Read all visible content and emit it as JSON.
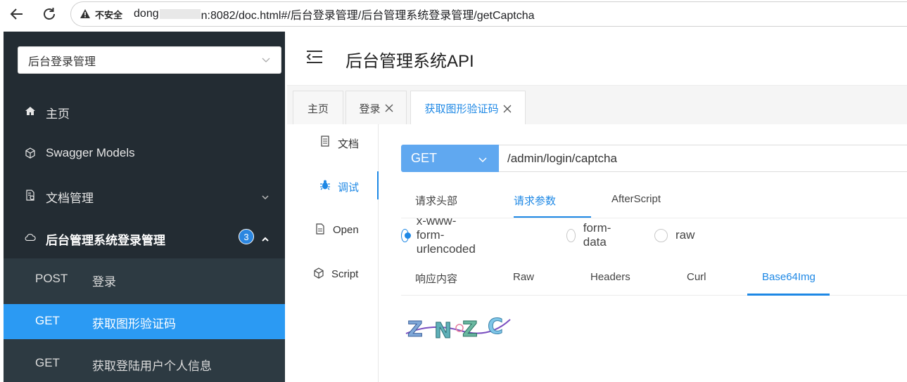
{
  "browser": {
    "insecure_label": "不安全",
    "url_host_start": "dong",
    "url_host_end": "n:8082/doc.html#/后台登录管理/后台管理系统登录管理/getCaptcha"
  },
  "sidebar": {
    "group_select": "后台登录管理",
    "menu": [
      {
        "label": "主页",
        "icon": "home-icon"
      },
      {
        "label": "Swagger Models",
        "icon": "cube-icon"
      },
      {
        "label": "文档管理",
        "icon": "doc-gear-icon"
      },
      {
        "label": "后台管理系统登录管理",
        "icon": "cloud-icon",
        "badge": "3"
      }
    ],
    "sub_items": [
      {
        "method": "POST",
        "label": "登录"
      },
      {
        "method": "GET",
        "label": "获取图形验证码"
      },
      {
        "method": "GET",
        "label": "获取登陆用户个人信息"
      }
    ]
  },
  "header": {
    "title": "后台管理系统API"
  },
  "tabs": [
    {
      "label": "主页"
    },
    {
      "label": "登录"
    },
    {
      "label": "获取图形验证码"
    }
  ],
  "vtabs": [
    {
      "label": "文档",
      "icon": "document-icon"
    },
    {
      "label": "调试",
      "icon": "bug-icon"
    },
    {
      "label": "Open",
      "icon": "file-icon"
    },
    {
      "label": "Script",
      "icon": "script-icon"
    }
  ],
  "debug": {
    "method": "GET",
    "path": "/admin/login/captcha",
    "sub_tabs": [
      "请求头部",
      "请求参数",
      "AfterScript"
    ],
    "content_types": [
      "x-www-form-urlencoded",
      "form-data",
      "raw"
    ],
    "resp_tabs": [
      "响应内容",
      "Raw",
      "Headers",
      "Curl",
      "Base64Img"
    ],
    "captcha_text": "ZNZC"
  },
  "colors": {
    "sidebar_bg": "#232c33",
    "accent": "#1e88e5",
    "active_item": "#2b9af3"
  }
}
